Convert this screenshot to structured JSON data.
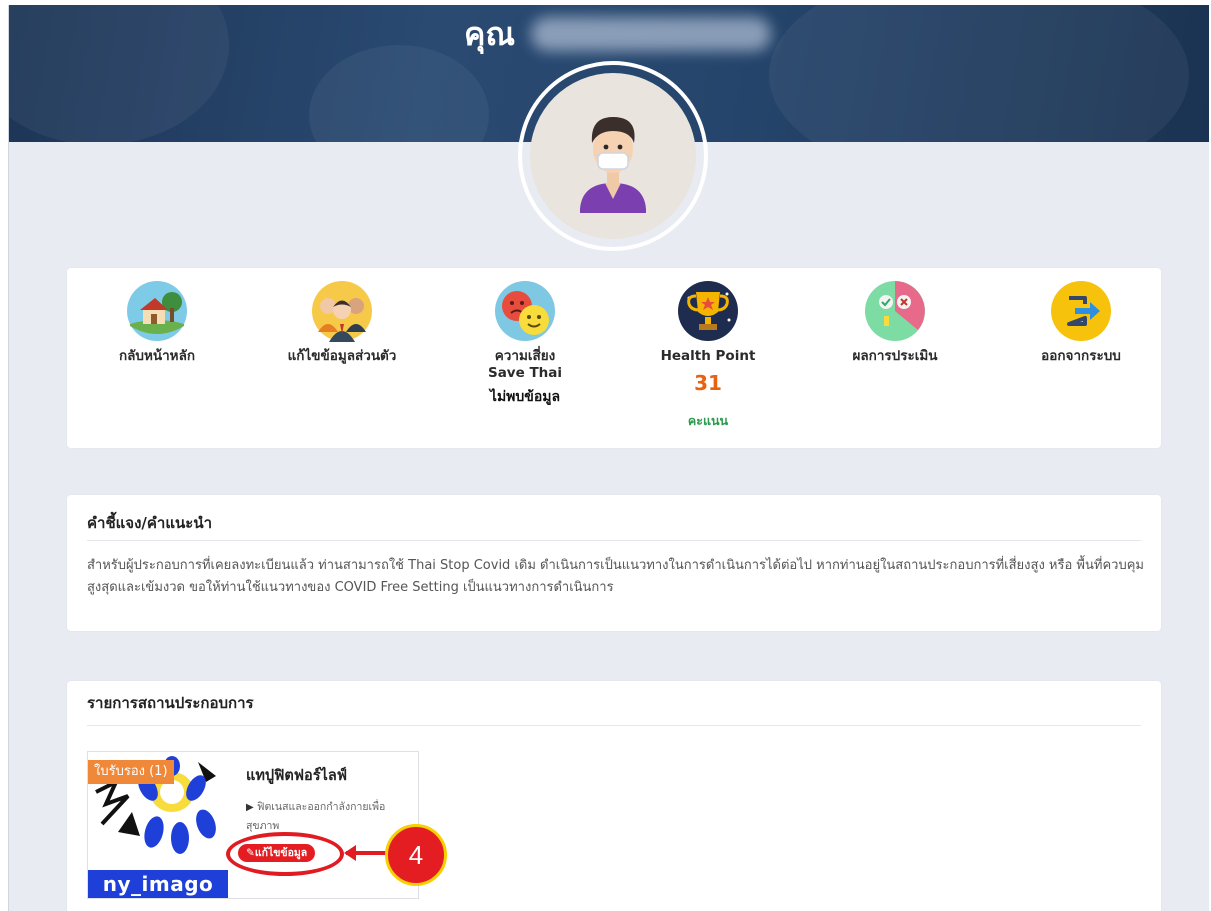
{
  "header": {
    "greeting": "คุณ"
  },
  "menu": {
    "items": [
      {
        "label": "กลับหน้าหลัก",
        "icon": "home-icon"
      },
      {
        "label": "แก้ไขข้อมูลส่วนตัว",
        "icon": "people-icon"
      },
      {
        "label": "ความเสี่ยง",
        "sublabel": "Save Thai",
        "status": "ไม่พบข้อมูล",
        "icon": "risk-faces-icon"
      },
      {
        "label": "Health Point",
        "value": "31",
        "unit": "คะแนน",
        "icon": "trophy-icon"
      },
      {
        "label": "ผลการประเมิน",
        "icon": "assessment-icon"
      },
      {
        "label": "ออกจากระบบ",
        "icon": "logout-icon"
      }
    ]
  },
  "info": {
    "title": "คำชี้แจง/คำแนะนำ",
    "text": "สำหรับผู้ประกอบการที่เคยลงทะเบียนแล้ว ท่านสามารถใช้ Thai Stop Covid เดิม ดำเนินการเป็นแนวทางในการดำเนินการได้ต่อไป หากท่านอยู่ในสถานประกอบการที่เสี่ยงสูง หรือ พื้นที่ควบคุมสูงสุดและเข้มงวด ขอให้ท่านใช้แนวทางของ COVID Free Setting เป็นแนวทางการดำเนินการ"
  },
  "businesses": {
    "title": "รายการสถานประกอบการ",
    "items": [
      {
        "badge": "ใบรับรอง (1)",
        "name": "แทปูฟิตฟอร์ไลฟ์",
        "category": "ฟิตเนสและออกกำลังกายเพื่อสุขภาพ",
        "thumb_text": "ny_imago",
        "edit_label": "แก้ไขข้อมูล"
      }
    ]
  },
  "annotation": {
    "step_number": "4"
  },
  "colors": {
    "header_bg": "#1f3a5f",
    "page_bg": "#e8ecf2",
    "points": "#e8620f",
    "points_unit": "#2e9a4f",
    "edit_button": "#e41d22",
    "badge": "#f0883a",
    "callout_border": "#f6d000"
  }
}
